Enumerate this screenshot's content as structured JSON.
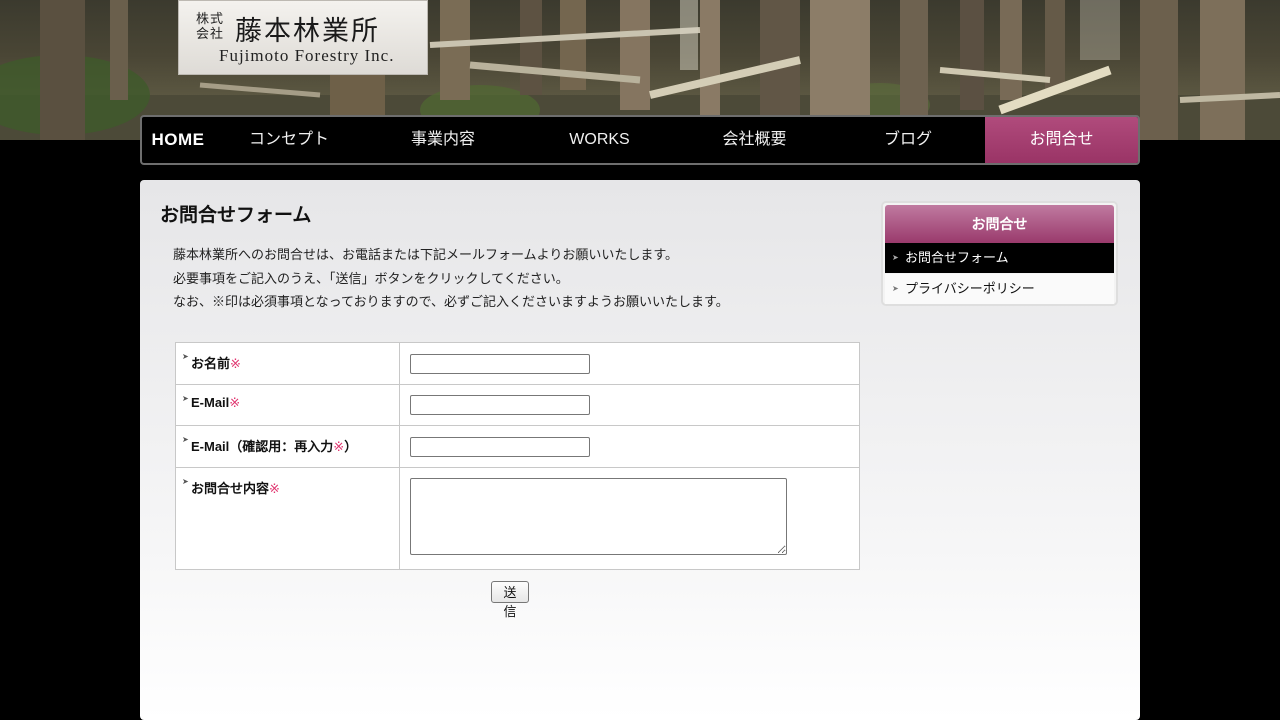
{
  "brand": {
    "prefix": "株式会社",
    "name_ja": "藤本林業所",
    "name_en": "Fujimoto Forestry Inc."
  },
  "nav": {
    "items": [
      {
        "label": "HOME"
      },
      {
        "label": "コンセプト"
      },
      {
        "label": "事業内容"
      },
      {
        "label": "WORKS"
      },
      {
        "label": "会社概要"
      },
      {
        "label": "ブログ"
      },
      {
        "label": "お問合せ",
        "active": true
      }
    ]
  },
  "page": {
    "title": "お問合せフォーム",
    "intro": [
      "藤本林業所へのお問合せは、お電話または下記メールフォームよりお願いいたします。",
      "必要事項をご記入のうえ、「送信」ボタンをクリックしてください。",
      "なお、※印は必須事項となっておりますので、必ずご記入くださいますようお願いいたします。"
    ]
  },
  "form": {
    "required_mark": "※",
    "fields": [
      {
        "label": "お名前",
        "value": ""
      },
      {
        "label": "E-Mail",
        "value": ""
      },
      {
        "label_before": "E-Mail（確認用：再入力",
        "label_after": "）",
        "value": ""
      },
      {
        "label": "お問合せ内容",
        "value": ""
      }
    ],
    "submit_label": "送 信"
  },
  "sidebar": {
    "title": "お問合せ",
    "items": [
      {
        "label": "お問合せフォーム",
        "active": true
      },
      {
        "label": "プライバシーポリシー"
      }
    ]
  },
  "colors": {
    "accent": "#9a3466",
    "required": "#e0336e",
    "nav_bg": "#000000"
  }
}
